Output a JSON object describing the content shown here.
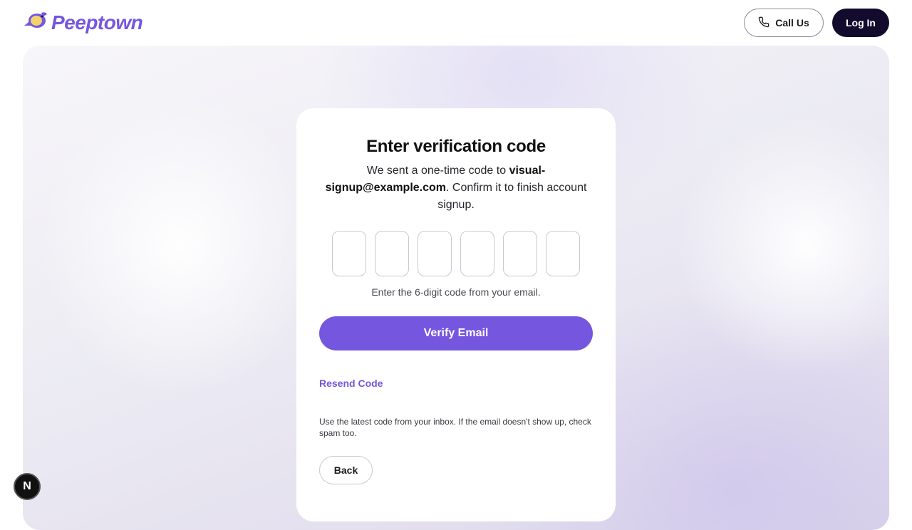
{
  "brand": {
    "name": "Peeptown",
    "accent": "#7556df",
    "dark": "#120b2e"
  },
  "header": {
    "call_label": "Call Us",
    "login_label": "Log In"
  },
  "card": {
    "title": "Enter verification code",
    "desc_prefix": "We sent a one-time code to ",
    "email": "visual-signup@example.com",
    "desc_suffix": ". Confirm it to finish account signup.",
    "otp_digits": [
      "",
      "",
      "",
      "",
      "",
      ""
    ],
    "hint": "Enter the 6-digit code from your email.",
    "verify_label": "Verify Email",
    "resend_label": "Resend Code",
    "note": "Use the latest code from your inbox. If the email doesn't show up, check spam too.",
    "back_label": "Back"
  },
  "dev_badge": {
    "label": "N"
  },
  "icons": {
    "logo": "bird-icon",
    "call": "phone-icon"
  }
}
